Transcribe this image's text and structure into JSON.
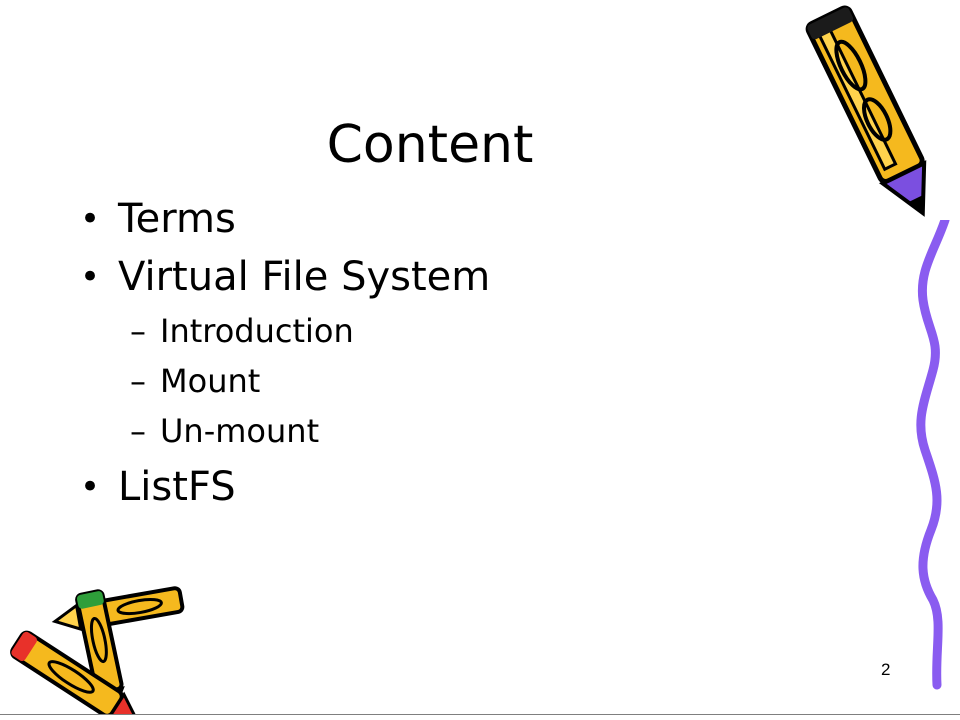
{
  "slide": {
    "title": "Content",
    "bullets": [
      {
        "marker": "•",
        "text": "Terms"
      },
      {
        "marker": "•",
        "text": "Virtual File System",
        "sub": [
          {
            "marker": "–",
            "text": "Introduction"
          },
          {
            "marker": "–",
            "text": "Mount"
          },
          {
            "marker": "–",
            "text": "Un-mount"
          }
        ]
      },
      {
        "marker": "•",
        "text": "ListFS"
      }
    ],
    "page_number": "2"
  },
  "colors": {
    "pencil_yellow": "#f5b91e",
    "pencil_outline": "#000000",
    "pencil_accent_purple": "#7b4fe0",
    "squiggle": "#8a5cf0",
    "pencil_red": "#e8312a",
    "pencil_green": "#2e9e3a"
  },
  "icons": [
    "pencil-icon",
    "crossed-pencils-icon",
    "decorative-squiggle"
  ]
}
